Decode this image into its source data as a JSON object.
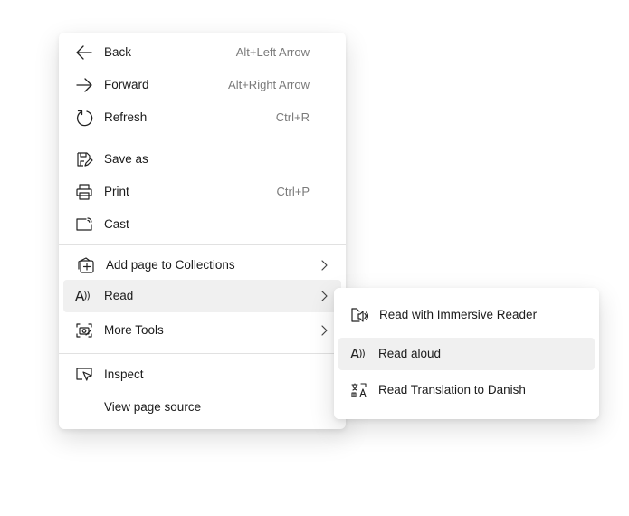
{
  "main_menu": {
    "items": [
      {
        "label": "Back",
        "shortcut": "Alt+Left Arrow",
        "icon": "arrow-left-icon"
      },
      {
        "label": "Forward",
        "shortcut": "Alt+Right Arrow",
        "icon": "arrow-right-icon"
      },
      {
        "label": "Refresh",
        "shortcut": "Ctrl+R",
        "icon": "refresh-icon"
      },
      {
        "label": "Save as",
        "shortcut": "",
        "icon": "save-as-icon"
      },
      {
        "label": "Print",
        "shortcut": "Ctrl+P",
        "icon": "print-icon"
      },
      {
        "label": "Cast",
        "shortcut": "",
        "icon": "cast-icon"
      },
      {
        "label": "Add page to Collections",
        "shortcut": "",
        "icon": "collections-icon",
        "submenu": true
      },
      {
        "label": "Read",
        "shortcut": "",
        "icon": "read-aloud-icon",
        "submenu": true,
        "highlighted": true
      },
      {
        "label": "More Tools",
        "shortcut": "",
        "icon": "more-tools-icon",
        "submenu": true
      },
      {
        "label": "Inspect",
        "shortcut": "",
        "icon": "inspect-icon"
      },
      {
        "label": "View page source",
        "shortcut": "",
        "icon": ""
      }
    ]
  },
  "read_submenu": {
    "items": [
      {
        "label": "Read with Immersive Reader",
        "icon": "immersive-reader-icon"
      },
      {
        "label": "Read aloud",
        "icon": "read-aloud-icon",
        "highlighted": true
      },
      {
        "label": "Read Translation to Danish",
        "icon": "translate-icon"
      }
    ]
  },
  "colors": {
    "menu_background": "#ffffff",
    "hover_background": "#f0f0f0",
    "divider": "#e1e1e1",
    "shortcut_text": "#7a7a7a"
  }
}
